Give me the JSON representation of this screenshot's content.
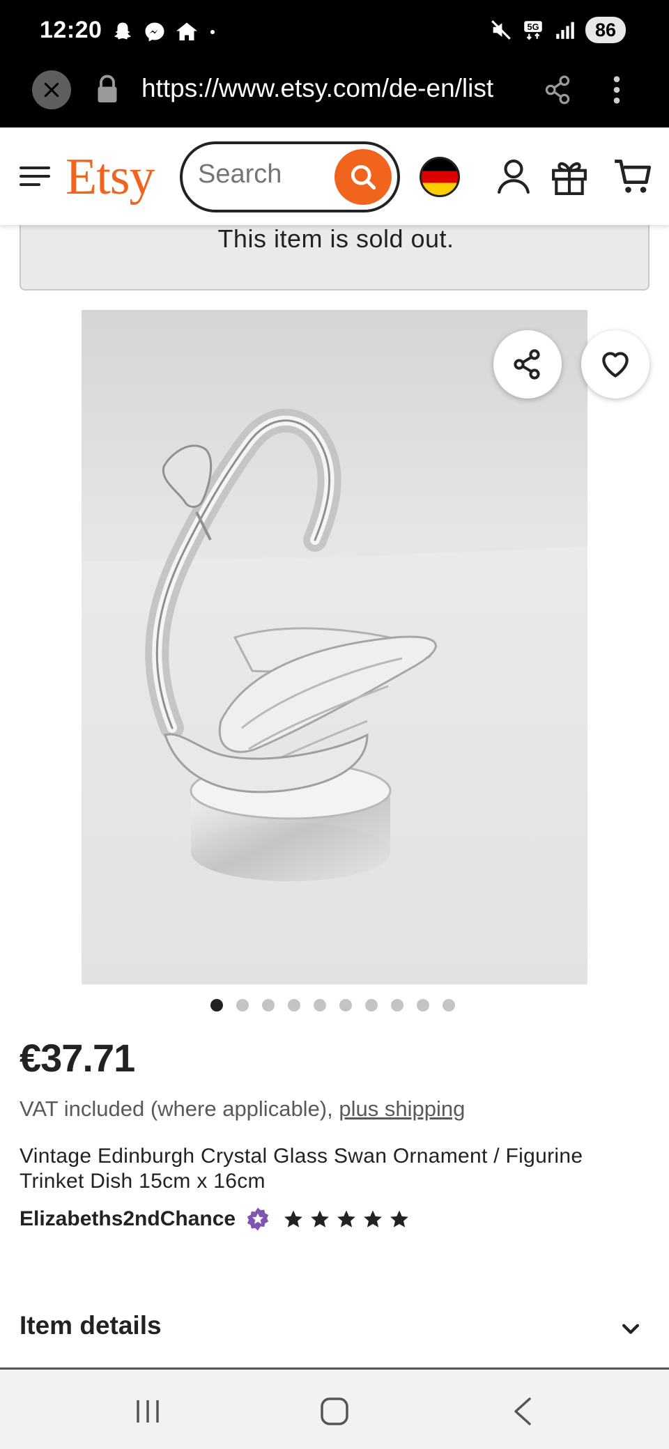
{
  "status_bar": {
    "time": "12:20",
    "battery": "86",
    "network": "5G"
  },
  "browser": {
    "url": "https://www.etsy.com/de-en/list"
  },
  "header": {
    "logo": "Etsy",
    "search_placeholder": "Search",
    "brand_color": "#f1641e"
  },
  "listing": {
    "sold_out_notice": "This item is sold out.",
    "image_count": 10,
    "active_image_index": 0,
    "price": "€37.71",
    "vat_text": "VAT included (where applicable), ",
    "shipping_link": "plus shipping",
    "title": "Vintage Edinburgh Crystal Glass Swan Ornament / Figurine Trinket Dish 15cm x 16cm",
    "shop_name": "Elizabeths2ndChance",
    "rating_stars": 5,
    "item_details_label": "Item details"
  },
  "icons": {
    "header": [
      "menu-icon",
      "search-icon",
      "flag-icon",
      "account-icon",
      "gift-icon",
      "cart-icon"
    ],
    "image_actions": [
      "share-icon",
      "heart-icon"
    ]
  }
}
